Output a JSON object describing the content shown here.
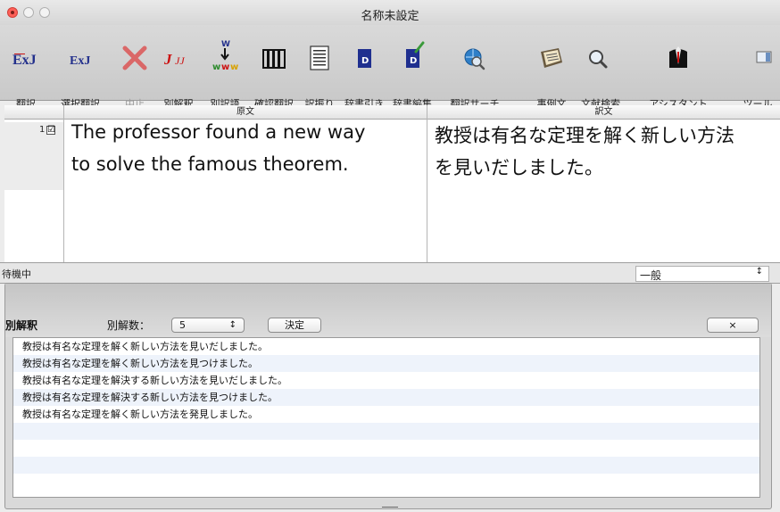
{
  "window": {
    "title": "名称未設定"
  },
  "toolbar": {
    "items": [
      {
        "label": "翻訳",
        "icon": "exj-translate-icon",
        "enabled": true
      },
      {
        "label": "選択翻訳",
        "icon": "exj-selection-icon",
        "enabled": true
      },
      {
        "label": "中止",
        "icon": "stop-x-icon",
        "enabled": false
      },
      {
        "label": "別解釈",
        "icon": "alternate-interpretation-icon",
        "enabled": true
      },
      {
        "label": "別訳語",
        "icon": "alternate-words-icon",
        "enabled": true
      },
      {
        "label": "確認翻訳",
        "icon": "columns-icon",
        "enabled": true
      },
      {
        "label": "訳振り",
        "icon": "lines-icon",
        "enabled": true
      },
      {
        "label": "辞書引き",
        "icon": "dictionary-icon",
        "enabled": true
      },
      {
        "label": "辞書編集",
        "icon": "dictionary-edit-icon",
        "enabled": true
      },
      {
        "label": "翻訳サーチ",
        "icon": "globe-search-icon",
        "enabled": true
      },
      {
        "label": "事例文",
        "icon": "example-book-icon",
        "enabled": true
      },
      {
        "label": "文献検索",
        "icon": "magnifier-icon",
        "enabled": true
      },
      {
        "label": "アシスタント",
        "icon": "assistant-icon",
        "enabled": true
      },
      {
        "label": "ツール",
        "icon": "tool-panel-icon",
        "enabled": true
      }
    ]
  },
  "table": {
    "col_source": "原文",
    "col_target": "訳文",
    "rows": [
      {
        "number": "1",
        "checked": "☑",
        "source": [
          "The professor found a new way",
          "to solve the famous theorem."
        ],
        "target": [
          "教授は有名な定理を解く新しい方法",
          "を見いだしました。"
        ]
      }
    ]
  },
  "status": {
    "text": "待機中",
    "genre": "一般"
  },
  "alt_panel": {
    "title": "別解釈",
    "count_label": "別解数：",
    "count_value": "5",
    "decide_label": "決定",
    "close_label": "×",
    "items": [
      "教授は有名な定理を解く新しい方法を見いだしました。",
      "教授は有名な定理を解く新しい方法を見つけました。",
      "教授は有名な定理を解決する新しい方法を見いだしました。",
      "教授は有名な定理を解決する新しい方法を見つけました。",
      "教授は有名な定理を解く新しい方法を発見しました。"
    ]
  },
  "colors": {
    "close_light": "#ff5f57",
    "exj_blue": "#23308c",
    "stop_red": "#d44",
    "j_red": "#c11"
  }
}
